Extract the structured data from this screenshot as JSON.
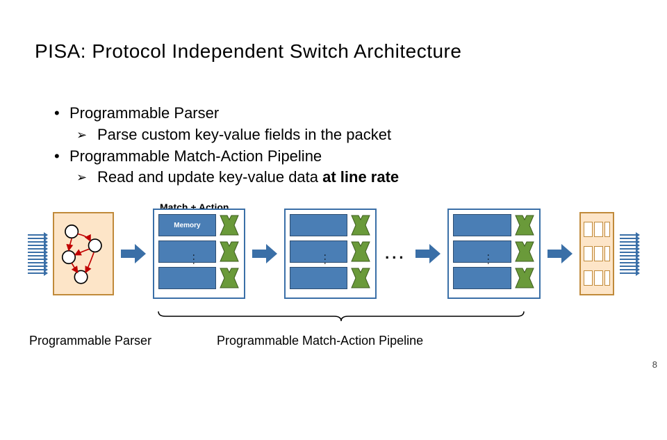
{
  "title": "PISA: Protocol Independent Switch Architecture",
  "bullets": {
    "b1": "Programmable Parser",
    "b1a": "Parse custom key-value fields in the packet",
    "b2": "Programmable Match-Action Pipeline",
    "b2a_prefix": "Read and update key-value data ",
    "b2a_bold": "at line rate"
  },
  "labels": {
    "match_action": "Match + Action",
    "memory": "Memory",
    "alu": "ALU",
    "parser": "Programmable Parser",
    "pipeline": "Programmable Match-Action Pipeline",
    "ellipsis": "..."
  },
  "page_number": "8"
}
